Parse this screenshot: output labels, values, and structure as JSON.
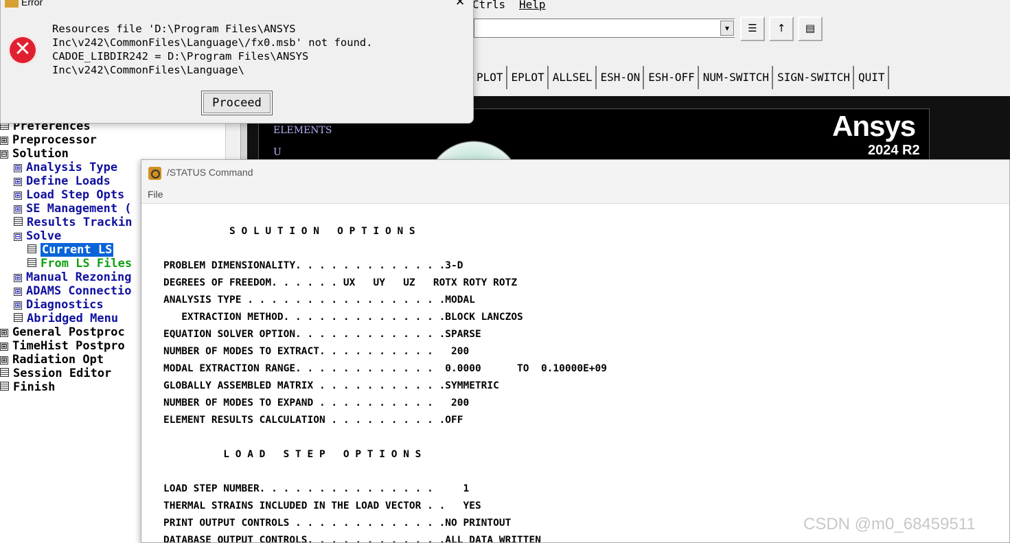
{
  "menubar": {
    "items": [
      "Ctrls",
      "Help"
    ]
  },
  "toolbar2": {
    "buttons": [
      "PLOT",
      "EPLOT",
      "ALLSEL",
      "ESH-ON",
      "ESH-OFF",
      "NUM-SWITCH",
      "SIGN-SWITCH",
      "QUIT"
    ]
  },
  "graphics": {
    "label1": "ELEMENTS",
    "label2": "U",
    "logo": "Ansys",
    "version": "2024 R2"
  },
  "tree": {
    "items": [
      {
        "label": "Preferences"
      },
      {
        "label": "Preprocessor",
        "exp": "⊞"
      },
      {
        "label": "Solution",
        "exp": "⊟"
      },
      {
        "label": "Analysis Type",
        "exp": "⊞"
      },
      {
        "label": "Define Loads",
        "exp": "⊞"
      },
      {
        "label": "Load Step Opts",
        "exp": "⊞"
      },
      {
        "label": "SE Management (",
        "exp": "⊞"
      },
      {
        "label": "Results Trackin"
      },
      {
        "label": "Solve",
        "exp": "⊟"
      },
      {
        "label": "Current LS"
      },
      {
        "label": "From LS Files"
      },
      {
        "label": "Manual Rezoning",
        "exp": "⊞"
      },
      {
        "label": "ADAMS Connectio",
        "exp": "⊞"
      },
      {
        "label": "Diagnostics",
        "exp": "⊞"
      },
      {
        "label": "Abridged Menu"
      },
      {
        "label": "General Postproc",
        "exp": "⊞"
      },
      {
        "label": "TimeHist Postpro",
        "exp": "⊞"
      },
      {
        "label": "Radiation Opt",
        "exp": "⊞"
      },
      {
        "label": "Session Editor"
      },
      {
        "label": "Finish"
      }
    ]
  },
  "error_dialog": {
    "title": "Error",
    "close": "✕",
    "icon": "✕",
    "message": "Resources file 'D:\\Program Files\\ANSYS\nInc\\v242\\CommonFiles\\Language\\/fx0.msb' not found.\nCADOE_LIBDIR242 = D:\\Program Files\\ANSYS\nInc\\v242\\CommonFiles\\Language\\",
    "button": "Proceed"
  },
  "status_window": {
    "title": "/STATUS  Command",
    "menu_file": "File",
    "lines": [
      "           S O L U T I O N   O P T I O N S",
      "PROBLEM DIMENSIONALITY. . . . . . . . . . . . .3-D",
      "DEGREES OF FREEDOM. . . . . . UX   UY   UZ   ROTX ROTY ROTZ",
      "ANALYSIS TYPE . . . . . . . . . . . . . . . . .MODAL",
      "   EXTRACTION METHOD. . . . . . . . . . . . . .BLOCK LANCZOS",
      "EQUATION SOLVER OPTION. . . . . . . . . . . . .SPARSE",
      "NUMBER OF MODES TO EXTRACT. . . . . . . . . .   200",
      "MODAL EXTRACTION RANGE. . . . . . . . . . . .  0.0000      TO  0.10000E+09",
      "GLOBALLY ASSEMBLED MATRIX . . . . . . . . . . .SYMMETRIC",
      "NUMBER OF MODES TO EXPAND . . . . . . . . . .   200",
      "ELEMENT RESULTS CALCULATION . . . . . . . . . .OFF",
      "          L O A D   S T E P   O P T I O N S",
      "LOAD STEP NUMBER. . . . . . . . . . . . . . .     1",
      "THERMAL STRAINS INCLUDED IN THE LOAD VECTOR . .   YES",
      "PRINT OUTPUT CONTROLS . . . . . . . . . . . . .NO PRINTOUT",
      "DATABASE OUTPUT CONTROLS. . . . . . . . . . . .ALL DATA WRITTEN"
    ]
  },
  "watermark": "CSDN @m0_68459511"
}
